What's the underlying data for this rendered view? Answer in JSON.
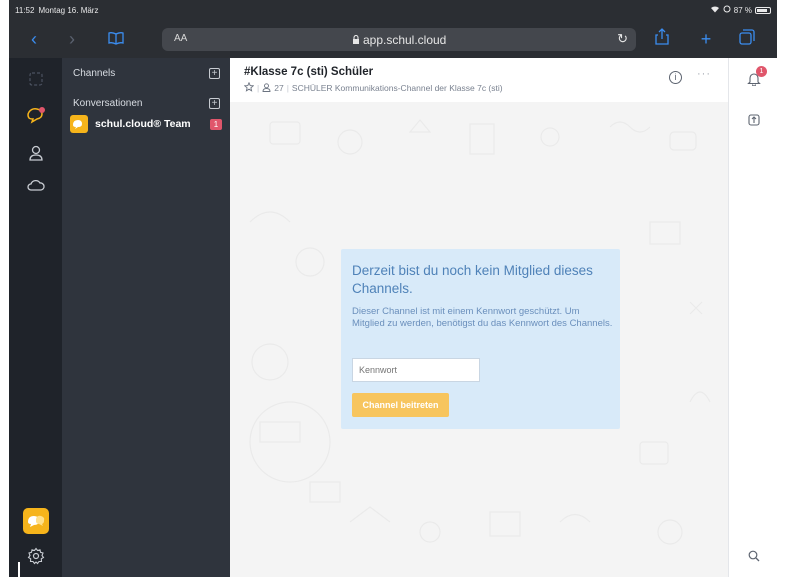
{
  "status_bar": {
    "time": "11:52",
    "date": "Montag 16. März",
    "battery": "87 %"
  },
  "browser": {
    "text_size_label": "AA",
    "url": "app.schul.cloud"
  },
  "sidebar": {
    "channels_label": "Channels",
    "conversations_label": "Konversationen",
    "conversations": [
      {
        "name": "schul.cloud® Team",
        "badge": "1"
      }
    ]
  },
  "room": {
    "title": "#Klasse 7c (sti) Schüler",
    "member_count": "27",
    "description": "SCHÜLER Kommunikations-Channel der Klasse 7c (sti)"
  },
  "join_box": {
    "heading": "Derzeit bist du noch kein Mitglied dieses Channels.",
    "text": "Dieser Channel ist mit einem Kennwort geschützt. Um Mitglied zu werden, benötigst du das Kennwort des Channels.",
    "password_placeholder": "Kennwort",
    "button_label": "Channel beitreten"
  },
  "right_rail": {
    "notification_badge": "1"
  },
  "colors": {
    "rail_bg": "#1f232a",
    "sidebar_bg": "#2f343d",
    "accent_yellow": "#f6b41b",
    "badge_red": "#e0566b",
    "join_box_bg": "#d8eaf9",
    "join_button": "#f7c55e"
  },
  "icons": [
    "back-icon",
    "forward-icon",
    "bookmarks-icon",
    "lock-icon",
    "reload-icon",
    "share-icon",
    "new-tab-icon",
    "tabs-icon",
    "home-icon",
    "chat-icon",
    "user-icon",
    "cloud-icon",
    "app-logo-icon",
    "settings-icon",
    "bell-icon",
    "pin-icon",
    "search-icon",
    "star-icon",
    "members-icon",
    "info-icon",
    "more-icon"
  ]
}
